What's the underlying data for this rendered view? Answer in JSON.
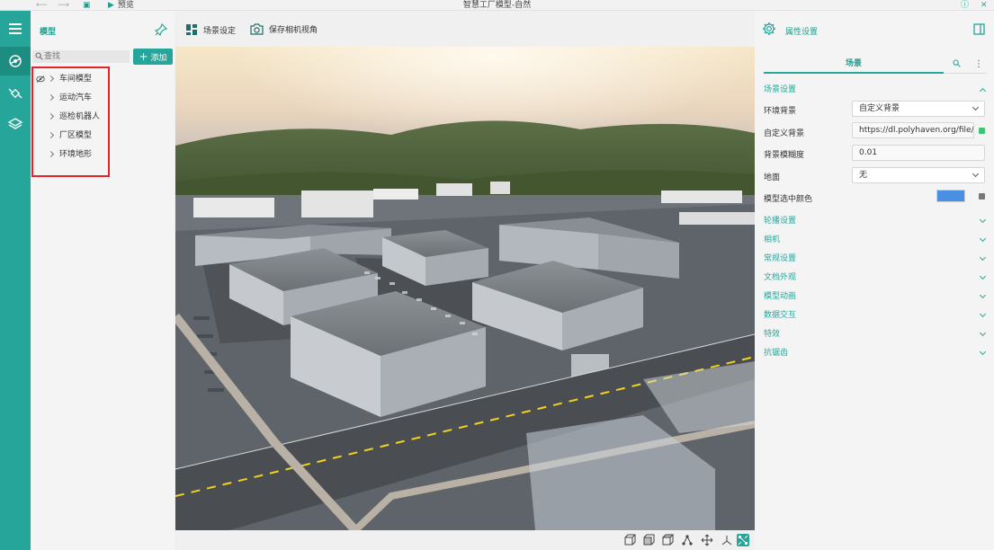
{
  "app": {
    "title": "智慧工厂模型-自然",
    "preview_label": "预览"
  },
  "colors": {
    "accent": "#26a69a",
    "accent_dark": "#1d8d82",
    "highlight_red": "#e3242b",
    "model_select_color": "#4a90e2"
  },
  "left_panel": {
    "title": "模型",
    "search_placeholder": "查找",
    "add_label": "添加",
    "tree": [
      {
        "label": "车间模型",
        "has_eye": true
      },
      {
        "label": "运动汽车"
      },
      {
        "label": "巡检机器人"
      },
      {
        "label": "厂区模型"
      },
      {
        "label": "环境地形"
      }
    ]
  },
  "toolbar": {
    "scene_settings": "场景设定",
    "save_camera": "保存相机视角"
  },
  "right_panel": {
    "title": "属性设置",
    "tab": "场景",
    "scene_settings_header": "场景设置",
    "props": {
      "env_bg_label": "环境背景",
      "env_bg_value": "自定义背景",
      "custom_bg_label": "自定义背景",
      "custom_bg_value": "https://dl.polyhaven.org/file/",
      "blur_label": "背景模糊度",
      "blur_value": "0.01",
      "ground_label": "地面",
      "ground_value": "无",
      "select_color_label": "模型选中颜色"
    },
    "sections": [
      "轮播设置",
      "相机",
      "常规设置",
      "文档外观",
      "模型动画",
      "数据交互",
      "特效",
      "抗锯齿"
    ]
  },
  "viewport": {
    "icons": [
      "cube-front-icon",
      "cube-side-icon",
      "cube-top-icon",
      "node-graph-icon",
      "move-icon",
      "axis-icon",
      "transform-icon"
    ]
  }
}
